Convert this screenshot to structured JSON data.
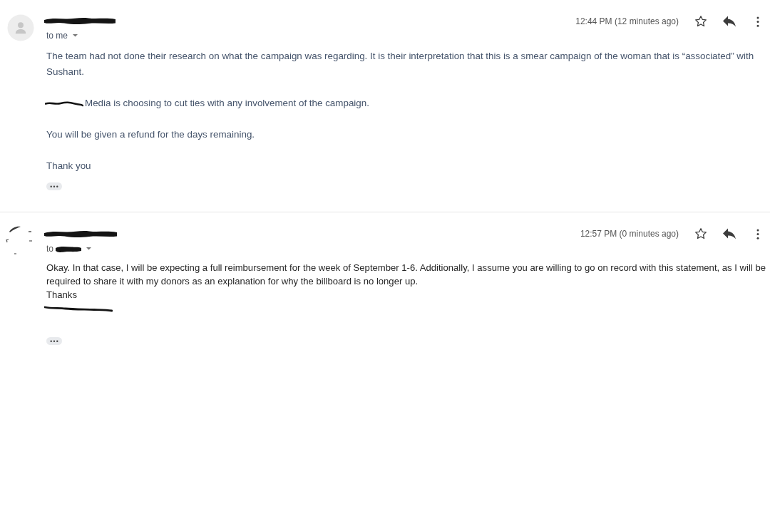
{
  "messages": [
    {
      "avatar": {
        "kind": "silhouette"
      },
      "sender_redacted": true,
      "recipient": {
        "label": "to me",
        "redacted": false
      },
      "time": "12:44 PM (12 minutes ago)",
      "starred": false,
      "paragraphs": [
        {
          "kind": "text",
          "text": "The team had not done their research on what the campaign was regarding. It is their interpretation that this is a smear campaign of the woman that is “associated” with Sushant."
        },
        {
          "kind": "redacted_text",
          "text": "Media is choosing to cut ties with any involvement of the campaign."
        },
        {
          "kind": "text",
          "text": "You will be given a refund for the days remaining."
        },
        {
          "kind": "text",
          "text": "Thank you"
        }
      ],
      "trimmed_toggle": true
    },
    {
      "avatar": {
        "kind": "photo"
      },
      "sender_redacted": true,
      "recipient": {
        "label": "to",
        "redacted": true
      },
      "time": "12:57 PM (0 minutes ago)",
      "starred": false,
      "paragraphs": [
        {
          "kind": "text",
          "text": "Okay. In that case, I will be expecting a full reimbursement for the week of September 1-6. Additionally, I assume you are willing to go on record with this statement, as I will be required to share it with my donors as an explanation for why the billboard is no longer up."
        },
        {
          "kind": "text",
          "text": "Thanks"
        },
        {
          "kind": "redaction"
        }
      ],
      "trimmed_toggle": true
    }
  ]
}
